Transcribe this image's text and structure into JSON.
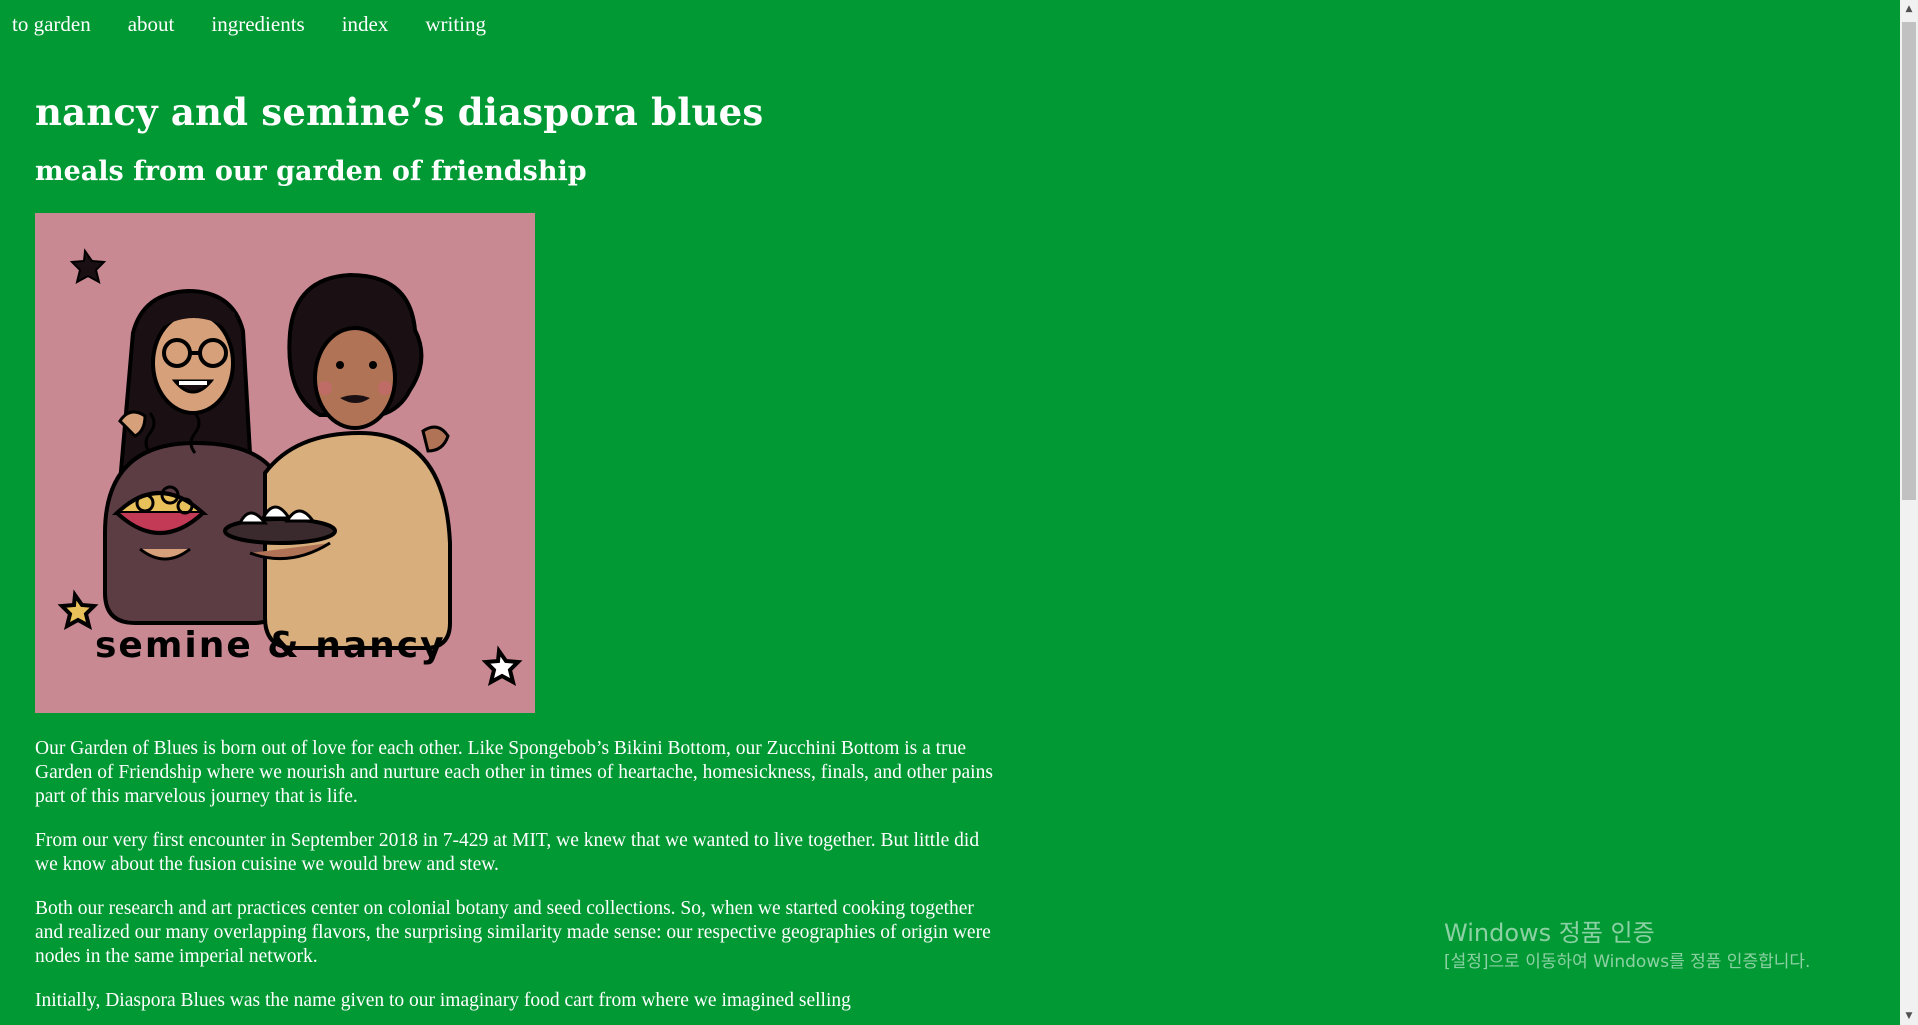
{
  "nav": {
    "items": [
      {
        "label": "to garden"
      },
      {
        "label": "about"
      },
      {
        "label": "ingredients"
      },
      {
        "label": "index"
      },
      {
        "label": "writing"
      }
    ]
  },
  "header": {
    "title": "nancy and semine’s diaspora blues",
    "subtitle": "meals from our garden of friendship"
  },
  "portrait": {
    "caption": "semine & nancy",
    "background_color": "#c98993"
  },
  "paragraphs": [
    "Our Garden of Blues is born out of love for each other. Like Spongebob’s Bikini Bottom, our Zucchini Bottom is a true Garden of Friendship where we nourish and nurture each other in times of heartache, homesickness, finals, and other pains part of this marvelous journey that is life.",
    "From our very first encounter in September 2018 in 7-429 at MIT, we knew that we wanted to live together. But little did we know about the fusion cuisine we would brew and stew.",
    "Both our research and art practices center on colonial botany and seed collections. So, when we started cooking together and realized our many overlapping flavors, the surprising similarity made sense: our respective geographies of origin were nodes in the same imperial network.",
    "Initially, Diaspora Blues was the name given to our imaginary food cart from where we imagined selling"
  ],
  "watermark": {
    "title": "Windows 정품 인증",
    "subtitle": "[설정]으로 이동하여 Windows를 정품 인증합니다."
  },
  "colors": {
    "background": "#009933",
    "text": "#ffffff"
  }
}
